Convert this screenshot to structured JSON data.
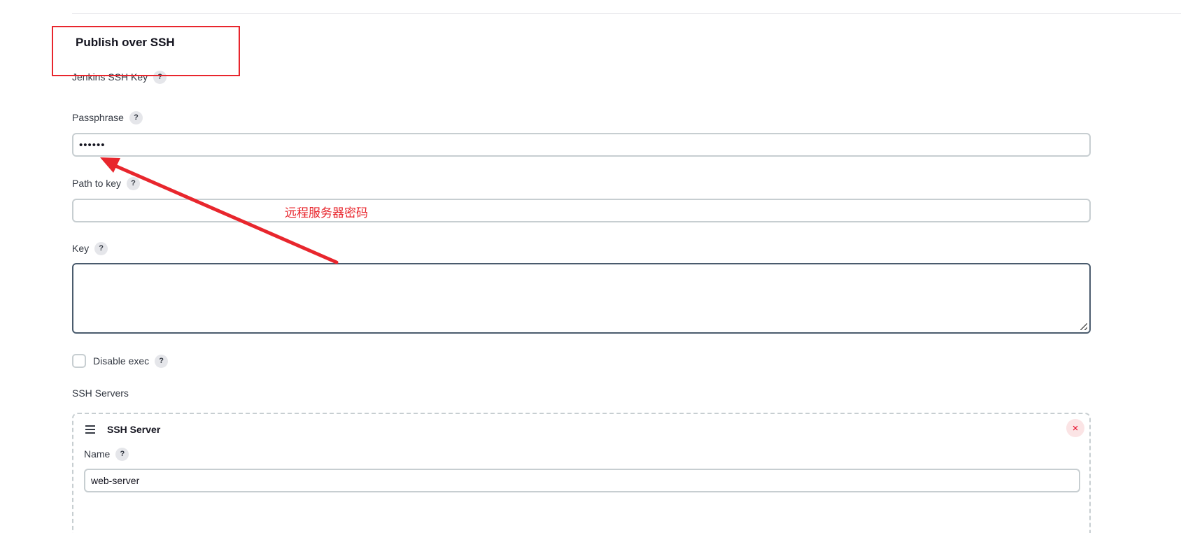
{
  "section": {
    "title": "Publish over SSH"
  },
  "fields": {
    "jenkins_ssh_key_label": "Jenkins SSH Key",
    "passphrase_label": "Passphrase",
    "passphrase_value": "••••••",
    "path_to_key_label": "Path to key",
    "path_to_key_value": "",
    "key_label": "Key",
    "key_value": "",
    "help_glyph": "?"
  },
  "options": {
    "disable_exec_label": "Disable exec",
    "disable_exec_checked": false
  },
  "servers": {
    "label": "SSH Servers",
    "items": [
      {
        "title": "SSH Server",
        "name_label": "Name",
        "name_value": "web-server",
        "delete_glyph": "×"
      }
    ]
  },
  "annotation": {
    "text": "远程服务器密码",
    "color": "#e8262d"
  },
  "colors": {
    "input_border": "#c7ced1",
    "focused_border": "#4a5b6d",
    "danger": "#e6001f"
  }
}
